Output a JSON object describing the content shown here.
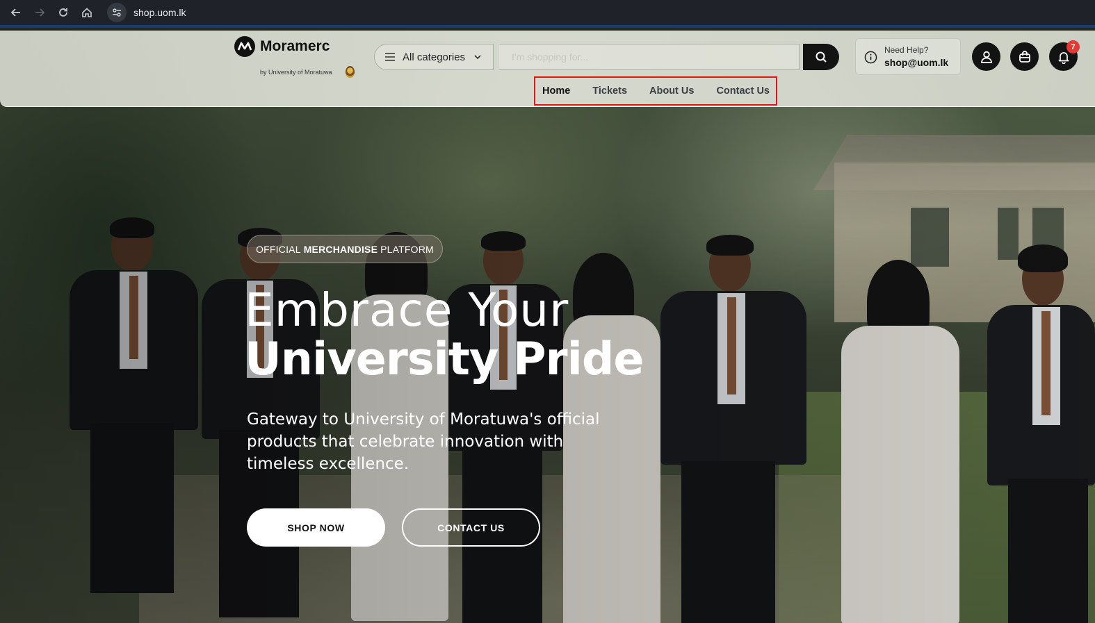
{
  "browser": {
    "url": "shop.uom.lk"
  },
  "header": {
    "brand": "Moramerc",
    "tagline": "by University of Moratuwa",
    "categories_label": "All categories",
    "search_placeholder": "I'm shopping for...",
    "help_label": "Need Help?",
    "help_email": "shop@uom.lk",
    "notification_count": "7",
    "nav": [
      "Home",
      "Tickets",
      "About Us",
      "Contact Us"
    ],
    "active_nav": "Home"
  },
  "hero": {
    "badge_prefix": "OFFICIAL",
    "badge_bold": "MERCHANDISE",
    "badge_suffix": "PLATFORM",
    "title_line1": "Embrace Your",
    "title_line2": "University Pride",
    "subtitle": "Gateway to University of Moratuwa's official products that celebrate innovation with timeless excellence.",
    "primary_cta": "SHOP NOW",
    "secondary_cta": "CONTACT US"
  },
  "colors": {
    "nav_highlight": "#e0141a",
    "dark_button": "#131313",
    "badge": "#e53935"
  }
}
